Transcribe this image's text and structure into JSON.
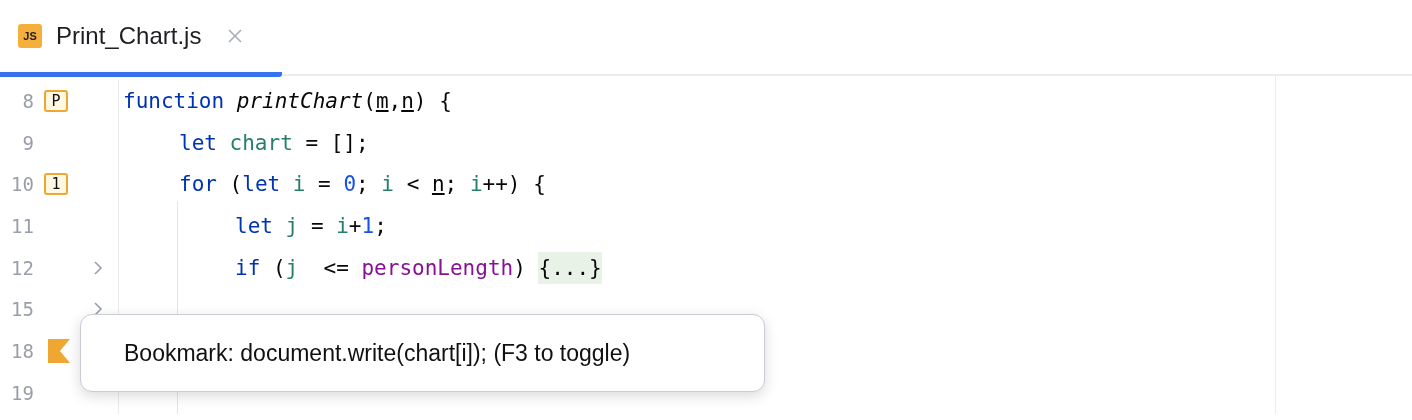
{
  "tabs": [
    {
      "label": "Print_Chart.js",
      "icon": "JS",
      "selected": true
    }
  ],
  "lines": [
    {
      "number": "8",
      "gutter": {
        "kind": "mnemonic",
        "label": "P"
      },
      "tokens": [
        {
          "kind": "keyword",
          "text": "function "
        },
        {
          "kind": "func",
          "text": "printChart"
        },
        {
          "kind": "plain",
          "text": "("
        },
        {
          "kind": "param",
          "text": "m"
        },
        {
          "kind": "plain",
          "text": ","
        },
        {
          "kind": "param",
          "text": "n"
        },
        {
          "kind": "plain",
          "text": ") {"
        }
      ],
      "children": [
        {
          "number": "9",
          "tokens": [
            {
              "kind": "keyword",
              "text": "let "
            },
            {
              "kind": "var",
              "text": "chart"
            },
            {
              "kind": "plain",
              "text": " = [];"
            }
          ]
        },
        {
          "number": "10",
          "gutter": {
            "kind": "mnemonic",
            "label": "1"
          },
          "tokens": [
            {
              "kind": "keyword",
              "text": "for"
            },
            {
              "kind": "plain",
              "text": " ("
            },
            {
              "kind": "keyword",
              "text": "let "
            },
            {
              "kind": "var",
              "text": "i"
            },
            {
              "kind": "plain",
              "text": " = "
            },
            {
              "kind": "number",
              "text": "0"
            },
            {
              "kind": "plain",
              "text": "; "
            },
            {
              "kind": "var",
              "text": "i"
            },
            {
              "kind": "plain",
              "text": " < "
            },
            {
              "kind": "param",
              "text": "n"
            },
            {
              "kind": "plain",
              "text": "; "
            },
            {
              "kind": "var",
              "text": "i"
            },
            {
              "kind": "plain",
              "text": "++) {"
            }
          ],
          "children": [
            {
              "number": "11",
              "tokens": [
                {
                  "kind": "keyword",
                  "text": "let "
                },
                {
                  "kind": "var",
                  "text": "j"
                },
                {
                  "kind": "plain",
                  "text": " = "
                },
                {
                  "kind": "var",
                  "text": "i"
                },
                {
                  "kind": "plain",
                  "text": "+"
                },
                {
                  "kind": "number",
                  "text": "1"
                },
                {
                  "kind": "plain",
                  "text": ";"
                }
              ]
            },
            {
              "number": "12",
              "gutter": {
                "kind": "fold"
              },
              "tokens": [
                {
                  "kind": "keyword",
                  "text": "if"
                },
                {
                  "kind": "plain",
                  "text": " ("
                },
                {
                  "kind": "var",
                  "text": "j"
                },
                {
                  "kind": "plain",
                  "text": "  <= "
                },
                {
                  "kind": "global",
                  "text": "personLength"
                },
                {
                  "kind": "plain",
                  "text": ") "
                },
                {
                  "kind": "folded",
                  "text": "{...}"
                }
              ]
            },
            {
              "number": "15",
              "gutter": {
                "kind": "fold"
              }
            },
            {
              "number": "18",
              "gutter": {
                "kind": "bookmark"
              }
            },
            {
              "number": "19"
            }
          ]
        }
      ]
    }
  ],
  "tooltip": {
    "text": "Bookmark: document.write(chart[i]); (F3 to toggle)"
  }
}
